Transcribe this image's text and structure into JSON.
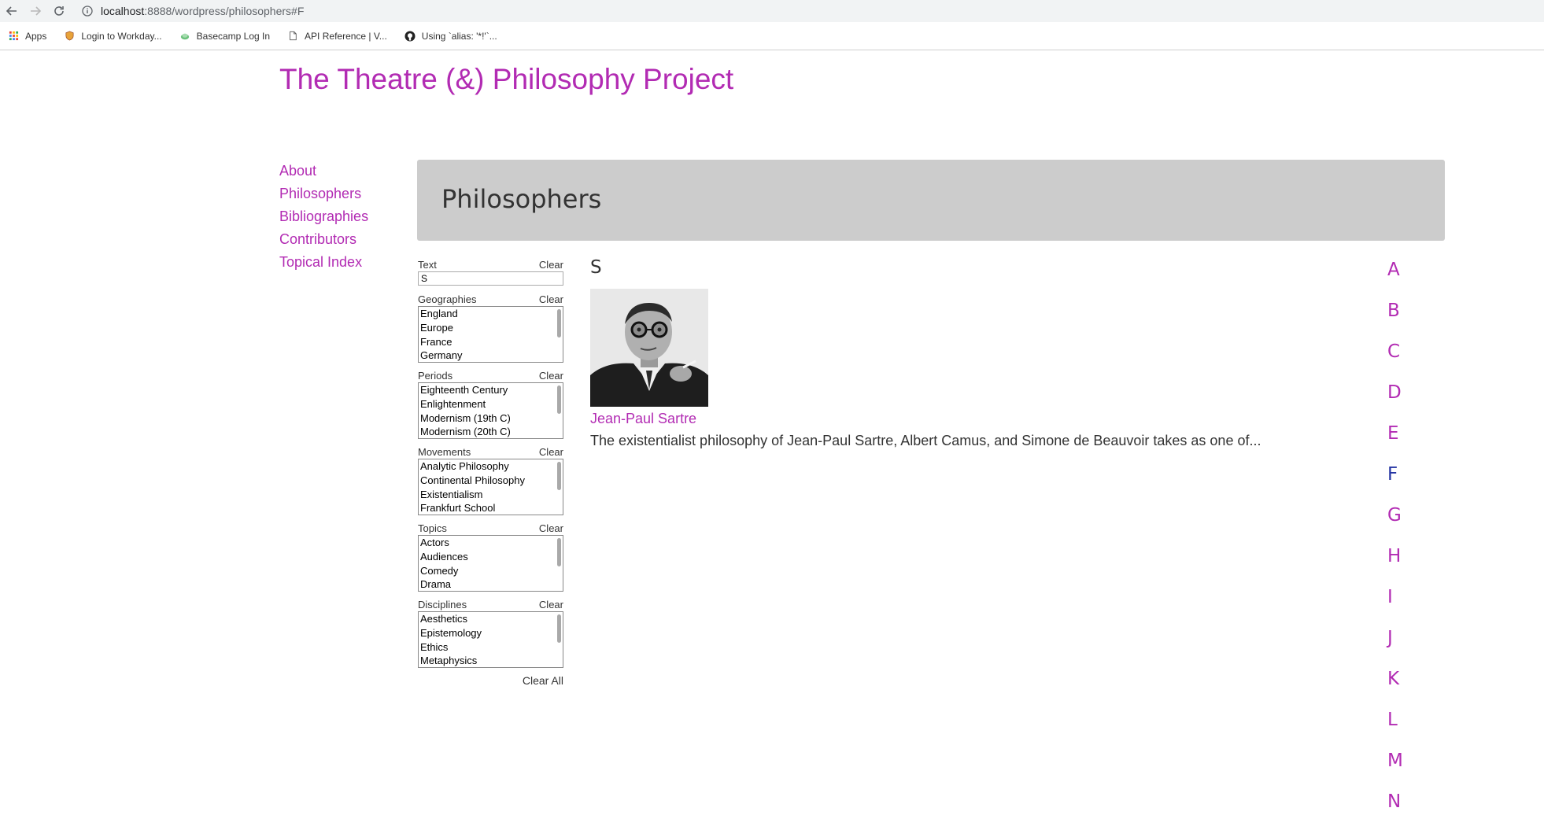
{
  "browser": {
    "url_host": "localhost",
    "url_rest": ":8888/wordpress/philosophers#F",
    "bookmarks": [
      {
        "label": "Apps",
        "icon": "apps-grid-icon"
      },
      {
        "label": "Login to Workday...",
        "icon": "shield-icon"
      },
      {
        "label": "Basecamp Log In",
        "icon": "basecamp-icon"
      },
      {
        "label": "API Reference | V...",
        "icon": "document-icon"
      },
      {
        "label": "Using `alias: '*!'`...",
        "icon": "github-icon"
      }
    ]
  },
  "site": {
    "title": "The Theatre (&) Philosophy Project",
    "accent_color": "#b22bb3"
  },
  "nav": {
    "items": [
      "About",
      "Philosophers",
      "Bibliographies",
      "Contributors",
      "Topical Index"
    ]
  },
  "page": {
    "heading": "Philosophers"
  },
  "filters": {
    "text": {
      "label": "Text",
      "clear": "Clear",
      "value": "S"
    },
    "geographies": {
      "label": "Geographies",
      "clear": "Clear",
      "options": [
        "England",
        "Europe",
        "France",
        "Germany"
      ]
    },
    "periods": {
      "label": "Periods",
      "clear": "Clear",
      "options": [
        "Eighteenth Century",
        "Enlightenment",
        "Modernism (19th C)",
        "Modernism (20th C)"
      ]
    },
    "movements": {
      "label": "Movements",
      "clear": "Clear",
      "options": [
        "Analytic Philosophy",
        "Continental Philosophy",
        "Existentialism",
        "Frankfurt School"
      ]
    },
    "topics": {
      "label": "Topics",
      "clear": "Clear",
      "options": [
        "Actors",
        "Audiences",
        "Comedy",
        "Drama"
      ]
    },
    "disciplines": {
      "label": "Disciplines",
      "clear": "Clear",
      "options": [
        "Aesthetics",
        "Epistemology",
        "Ethics",
        "Metaphysics"
      ]
    },
    "clear_all": "Clear All"
  },
  "results": {
    "letter": "S",
    "items": [
      {
        "name": "Jean-Paul Sartre",
        "excerpt": "The existentialist philosophy of Jean-Paul Sartre, Albert Camus, and Simone de Beauvoir takes as one of..."
      }
    ]
  },
  "alphabet": {
    "letters": [
      "A",
      "B",
      "C",
      "D",
      "E",
      "F",
      "G",
      "H",
      "I",
      "J",
      "K",
      "L",
      "M",
      "N"
    ],
    "visited": "F",
    "visited_color": "#2434a3"
  }
}
